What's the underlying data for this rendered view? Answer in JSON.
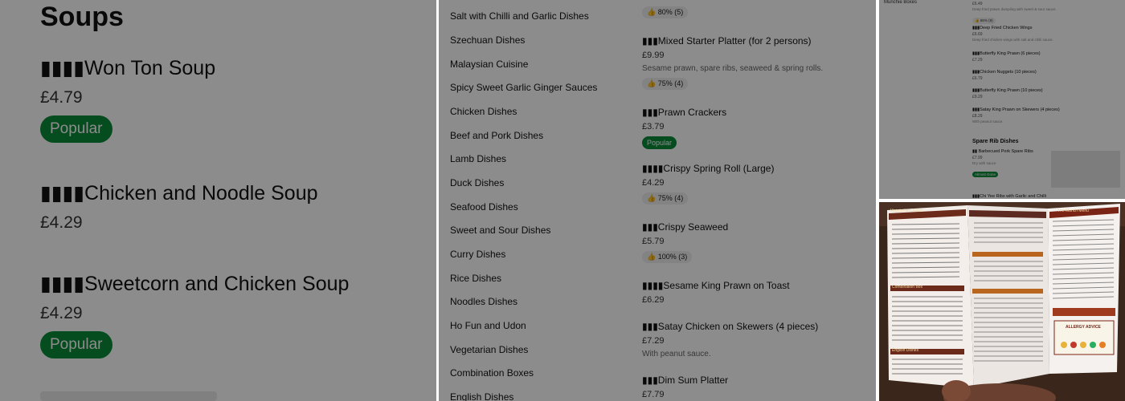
{
  "panel1": {
    "section_title": "Soups",
    "items": [
      {
        "name": "▮▮▮▮Won Ton Soup",
        "price": "£4.79",
        "badge": "Popular"
      },
      {
        "name": "▮▮▮▮Chicken and Noodle Soup",
        "price": "£4.29"
      },
      {
        "name": "▮▮▮▮Sweetcorn and Chicken Soup",
        "price": "£4.29",
        "badge": "Popular"
      }
    ]
  },
  "panel2": {
    "categories": [
      "Salt with Chilli and Garlic Dishes",
      "Szechuan Dishes",
      "Malaysian Cuisine",
      "Spicy Sweet Garlic Ginger Sauces",
      "Chicken Dishes",
      "Beef and Pork Dishes",
      "Lamb Dishes",
      "Duck Dishes",
      "Seafood Dishes",
      "Sweet and Sour Dishes",
      "Curry Dishes",
      "Rice Dishes",
      "Noodles Dishes",
      "Ho Fun and Udon",
      "Vegetarian Dishes",
      "Combination Boxes",
      "English Dishes"
    ],
    "top_rating": "👍 80% (5)",
    "items": [
      {
        "name": "▮▮▮Mixed Starter Platter (for 2 persons)",
        "price": "£9.99",
        "desc": "Sesame prawn, spare ribs, seaweed & spring rolls.",
        "rating": "👍 75% (4)"
      },
      {
        "name": "▮▮▮Prawn Crackers",
        "price": "£3.79",
        "badge": "Popular"
      },
      {
        "name": "▮▮▮▮Crispy Spring Roll (Large)",
        "price": "£4.29",
        "rating": "👍 75% (4)"
      },
      {
        "name": "▮▮▮Crispy Seaweed",
        "price": "£5.79",
        "rating": "👍 100% (3)"
      },
      {
        "name": "▮▮▮▮Sesame King Prawn on Toast",
        "price": "£6.29"
      },
      {
        "name": "▮▮▮Satay Chicken on Skewers (4 pieces)",
        "price": "£7.29",
        "desc": "With peanut sauce."
      },
      {
        "name": "▮▮▮Dim Sum Platter",
        "price": "£7.79"
      }
    ]
  },
  "panel3": {
    "category": "Munchie Boxes",
    "top_price": "£6.49",
    "top_desc": "Deep fried prawn dumpling with sweet & sour sauce.",
    "top_rating": "👍 86% (9)",
    "items": [
      {
        "name": "▮▮▮Deep Fried Chicken Wings",
        "price": "£6.69",
        "desc": "Deep fried chicken wings with salt and chilli sauce."
      },
      {
        "name": "▮▮▮Butterfly King Prawn (6 pieces)",
        "price": "£7.29"
      },
      {
        "name": "▮▮▮Chicken Nuggets (10 pieces)",
        "price": "£6.79"
      },
      {
        "name": "▮▮▮Butterfly King Prawn (10 pieces)",
        "price": "£9.29"
      },
      {
        "name": "▮▮▮Satay King Prawn on Skewers (4 pieces)",
        "price": "£8.29",
        "desc": "With peanut sauce."
      }
    ],
    "section_title": "Spare Rib Dishes",
    "section_item": {
      "name": "▮▮ Barbecued Pork Spare Ribs",
      "price": "£7.99",
      "desc": "Dry with sauce",
      "badge": "Almost Gone"
    },
    "bottom_partial": "▮▮▮Chi Yee Ribs with Garlic and Chilli"
  },
  "panel4": {
    "heading_left": "Vegetarian Dishes",
    "heading_mid": "Combination Box",
    "heading_right": "The Munch Menu",
    "heading_english": "English Dishes",
    "heading_allergy": "ALLERGY ADVICE"
  }
}
